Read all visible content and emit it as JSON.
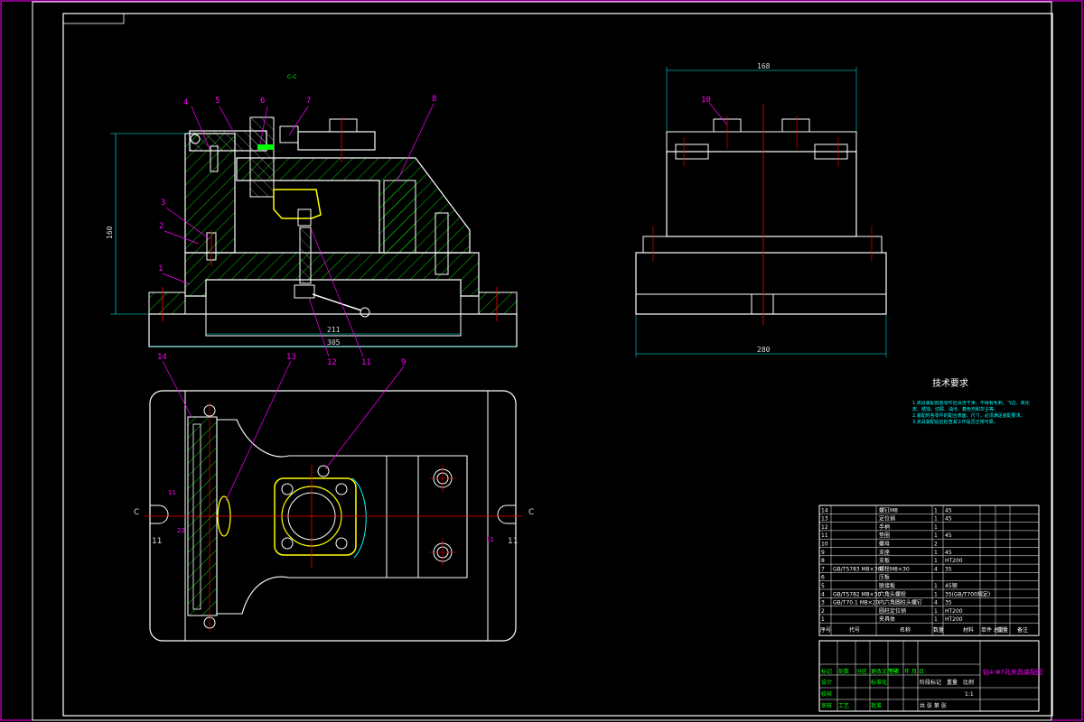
{
  "sheet": {
    "colors": {
      "background": "#000000",
      "outline": "#ffffff",
      "centerline": "#ff0000",
      "hatch": "#00ff00",
      "leader": "#ff00ff",
      "note": "#00ffff",
      "workpiece": "#ffff00",
      "cross_section": "#00ffff"
    }
  },
  "top_label": "C-C",
  "front_view": {
    "callouts": [
      "4",
      "5",
      "6",
      "7",
      "8",
      "3",
      "2",
      "1",
      "12",
      "11"
    ],
    "dims": {
      "height": "160",
      "width_inner": "211",
      "width_outer": "305"
    }
  },
  "side_view": {
    "callouts": [
      "10"
    ],
    "dims": {
      "top_width": "168",
      "bottom_width": "280"
    }
  },
  "plan_view": {
    "callouts": [
      "14",
      "13",
      "9"
    ],
    "section_marks": {
      "left": "C",
      "right": "C"
    },
    "small_labels": [
      "11",
      "22",
      "11",
      "11",
      "11"
    ]
  },
  "notes": {
    "title": "技术要求",
    "items": [
      "1.夹具装配前各零件应清洗干净，不得有毛刺、飞边、氧化皮、锈蚀、切屑、油污、着色剂和灰尘等。",
      "2.装配时各零件的配合表面、尺寸，必须满足装配要求。",
      "3.夹具装配后应检查其工作是否正常可靠。"
    ]
  },
  "bom": {
    "rows": [
      {
        "no": "14",
        "code": "",
        "name": "螺钉M8",
        "qty": "1",
        "mat": "45"
      },
      {
        "no": "13",
        "code": "",
        "name": "定位销",
        "qty": "1",
        "mat": "45"
      },
      {
        "no": "12",
        "code": "",
        "name": "手柄",
        "qty": "1",
        "mat": ""
      },
      {
        "no": "11",
        "code": "",
        "name": "垫圈",
        "qty": "1",
        "mat": "45"
      },
      {
        "no": "10",
        "code": "",
        "name": "螺母",
        "qty": "2",
        "mat": ""
      },
      {
        "no": "9",
        "code": "",
        "name": "支座",
        "qty": "1",
        "mat": "45"
      },
      {
        "no": "8",
        "code": "",
        "name": "支板",
        "qty": "1",
        "mat": "HT200"
      },
      {
        "no": "7",
        "code": "GB/T5783 M8×30",
        "name": "螺栓M8×30",
        "qty": "4",
        "mat": "35"
      },
      {
        "no": "6",
        "code": "",
        "name": "压板",
        "qty": "",
        "mat": ""
      },
      {
        "no": "5",
        "code": "",
        "name": "联接板",
        "qty": "1",
        "mat": "45钢"
      },
      {
        "no": "4",
        "code": "GB/T5782 M8×30",
        "name": "六角头螺栓",
        "qty": "1",
        "mat": "35(GB/T700规定)"
      },
      {
        "no": "3",
        "code": "GB/T70.1 M8×20",
        "name": "内六角圆柱头螺钉",
        "qty": "4",
        "mat": "35"
      },
      {
        "no": "2",
        "code": "",
        "name": "圆柱定位销",
        "qty": "1",
        "mat": "HT200"
      },
      {
        "no": "1",
        "code": "",
        "name": "夹具体",
        "qty": "1",
        "mat": "HT200"
      }
    ],
    "headers": {
      "no": "序号",
      "code": "代号",
      "name": "名称",
      "qty": "数量",
      "mat": "材料",
      "unit": "单件 总计",
      "mass": "重量",
      "remark": "备注"
    }
  },
  "title_block": {
    "drawing_name": "钻4-Φ7孔夹具装配图",
    "row_labels": [
      "标记",
      "处数",
      "分区",
      "更改文件号",
      "签名",
      "年 月 日"
    ],
    "left_labels": [
      "设计",
      "校核",
      "审核",
      "工艺"
    ],
    "mid_labels": [
      "标准化",
      "批准"
    ],
    "stage_labels": [
      "阶段标记",
      "重量",
      "比例"
    ],
    "scale": "1:1",
    "sheet_info": "共  张  第  张"
  }
}
